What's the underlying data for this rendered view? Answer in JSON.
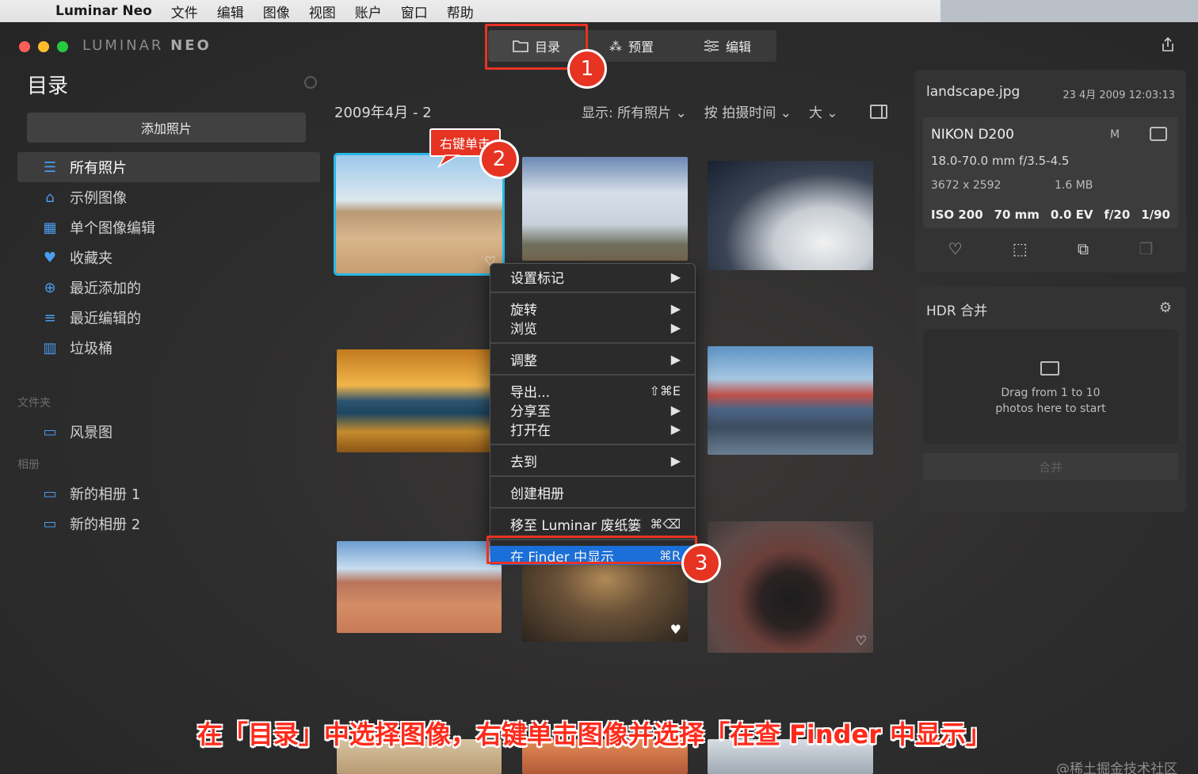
{
  "menubar": {
    "app": "Luminar Neo",
    "items": [
      "文件",
      "编辑",
      "图像",
      "视图",
      "账户",
      "窗口",
      "帮助"
    ]
  },
  "logo": {
    "part1": "LUMINAR",
    "part2": "NEO"
  },
  "tabs": [
    {
      "label": "目录",
      "icon": "folder-icon"
    },
    {
      "label": "预置",
      "icon": "magic-wand-icon"
    },
    {
      "label": "编辑",
      "icon": "sliders-icon"
    }
  ],
  "sidebar": {
    "title": "目录",
    "add_button": "添加照片",
    "items": [
      {
        "label": "所有照片",
        "icon": "stack-icon"
      },
      {
        "label": "示例图像",
        "icon": "graduation-cap-icon"
      },
      {
        "label": "单个图像编辑",
        "icon": "grid-icon"
      },
      {
        "label": "收藏夹",
        "icon": "heart-icon"
      },
      {
        "label": "最近添加的",
        "icon": "plus-circle-icon"
      },
      {
        "label": "最近编辑的",
        "icon": "sliders-icon"
      },
      {
        "label": "垃圾桶",
        "icon": "trash-icon"
      }
    ],
    "folders_header": "文件夹",
    "folder": "风景图",
    "albums_header": "相册",
    "albums": [
      "新的相册 1",
      "新的相册 2"
    ]
  },
  "gallery": {
    "date_range": "2009年4月 - 2",
    "show_label": "显示:",
    "show_value": "所有照片",
    "sort": "按 拍摄时间",
    "size": "大"
  },
  "context_menu": [
    {
      "label": "设置标记",
      "shortcut": "▶"
    },
    {
      "label": "旋转",
      "shortcut": "▶"
    },
    {
      "label": "浏览",
      "shortcut": "▶"
    },
    {
      "label": "调整",
      "shortcut": "▶"
    },
    {
      "label": "导出...",
      "shortcut": "⇧⌘E"
    },
    {
      "label": "分享至",
      "shortcut": "▶"
    },
    {
      "label": "打开在",
      "shortcut": "▶"
    },
    {
      "label": "去到",
      "shortcut": "▶"
    },
    {
      "label": "创建相册",
      "shortcut": ""
    },
    {
      "label": "移至 Luminar 废纸篓",
      "shortcut": "⌘⌫"
    },
    {
      "label": "在 Finder 中显示",
      "shortcut": "⌘R"
    }
  ],
  "info": {
    "filename": "landscape.jpg",
    "date": "23 4月 2009 12:03:13",
    "camera": "NIKON D200",
    "mode": "M",
    "lens": "18.0-70.0 mm f/3.5-4.5",
    "resolution": "3672 x 2592",
    "filesize": "1.6 MB",
    "iso": "ISO 200",
    "focal": "70 mm",
    "ev": "0.0 EV",
    "aperture": "f/20",
    "shutter": "1/90"
  },
  "hdr": {
    "title": "HDR 合并",
    "drop_line1": "Drag from 1 to 10",
    "drop_line2": "photos here to start",
    "merge_button": "合并"
  },
  "annotations": {
    "badge1": "1",
    "badge2": "2",
    "badge3": "3",
    "callout": "右键单击",
    "caption": "在「目录」中选择图像，右键单击图像并选择「在查 Finder 中显示」"
  },
  "watermark": "@稀土掘金技术社区"
}
